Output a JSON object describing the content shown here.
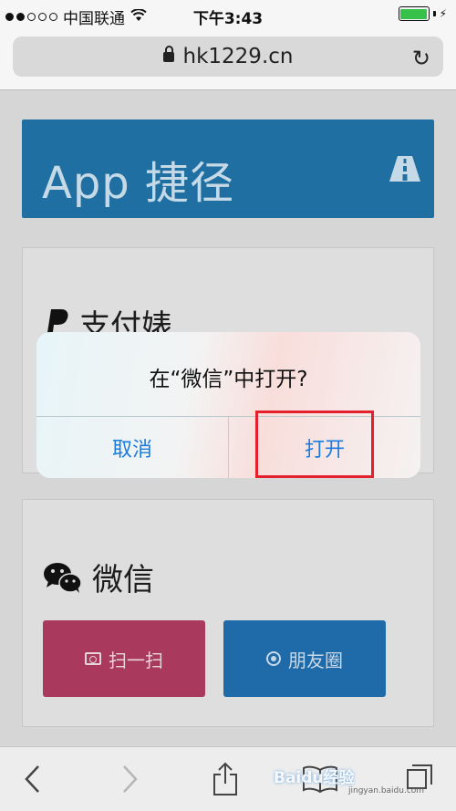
{
  "status_bar": {
    "carrier": "中国联通",
    "time": "下午3:43"
  },
  "browser": {
    "url": "hk1229.cn"
  },
  "header": {
    "title": "App 捷径"
  },
  "cards": {
    "alipay": {
      "title": "支付婊"
    },
    "wechat": {
      "title": "微信",
      "scan_label": "扫一扫",
      "moments_label": "朋友圈"
    }
  },
  "dialog": {
    "title": "在“微信”中打开?",
    "cancel_label": "取消",
    "open_label": "打开"
  },
  "watermark": {
    "brand": "Baidu经验",
    "url": "jingyan.baidu.com"
  },
  "colors": {
    "header": "#1f6fa3",
    "scan_button": "#a93a5d",
    "moments_button": "#1f6aa8",
    "dialog_action": "#1b7be0",
    "highlight": "#e3202c"
  }
}
